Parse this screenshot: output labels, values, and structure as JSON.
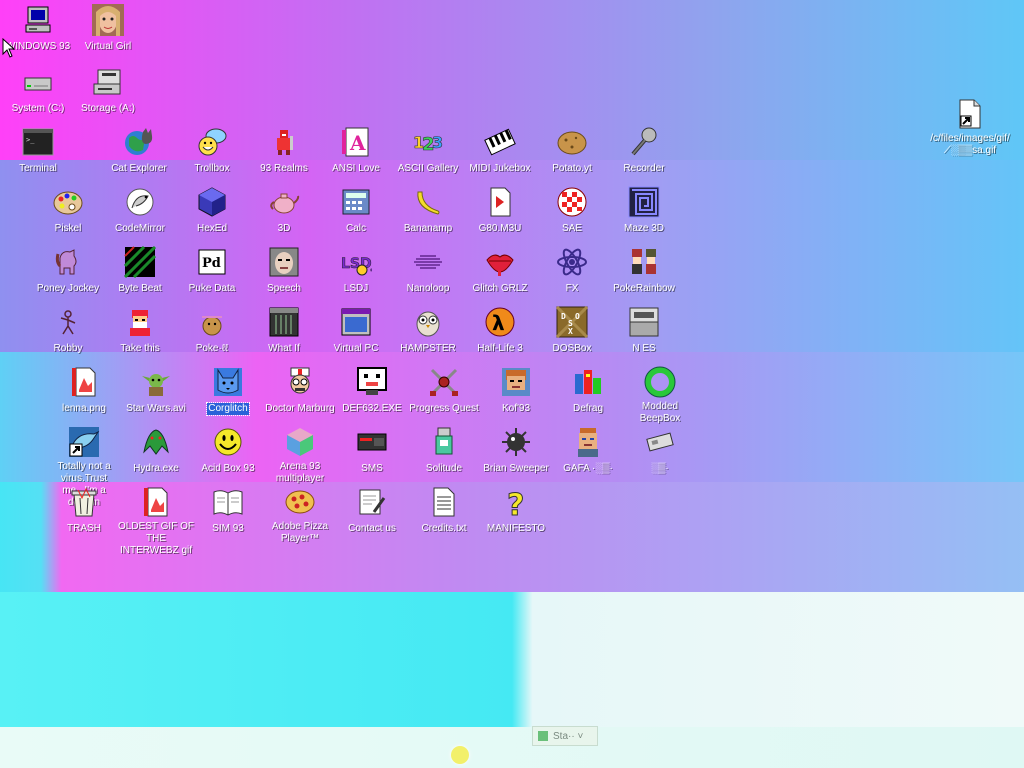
{
  "desktop": {
    "row1": [
      "WINDOWS 93",
      "Virtual Girl"
    ],
    "row2": [
      "System (C:)",
      "Storage (A:)"
    ],
    "shortcut": "/c/files/images/gif/⟋░▒▒sa.gif",
    "row3": [
      "Terminal",
      "Cat Explorer",
      "Trollbox",
      "93 Realms",
      "ANSI Love",
      "ASCII Gallery",
      "MIDI Jukebox",
      "Potato.yt",
      "Recorder"
    ],
    "row4": [
      "Piskel",
      "CodeMirror",
      "HexEd",
      "3D",
      "Calc",
      "Bananamp",
      "G80.M3U",
      "SAE",
      "Maze 3D"
    ],
    "row5": [
      "Poney Jockey",
      "Byte Beat",
      "Puke Data",
      "Speech",
      "LSDJ",
      "Nanoloop",
      "Glitch GRLZ",
      "FX",
      "PokeRainbow"
    ],
    "row6": [
      "Robby",
      "Take this",
      "Poke·ℓℓ",
      "What If",
      "Virtual PC",
      "HAMPSTER",
      "Half-Life 3",
      "DOSBox",
      "N  ES"
    ],
    "row7": [
      "lenna.png",
      "Star Wars.avi",
      "Corglitch",
      "Doctor Marburg",
      "DEF632.EXE",
      "Progress Quest",
      "Kof'93",
      "Defrag",
      "Modded BeepBox"
    ],
    "row8": [
      "Totally not a virus.Trust me...I'm a dolphin",
      "Hydra.exe",
      "Acid Box 93",
      "Arena 93 multiplayer",
      "SMS",
      "Solitude",
      "Brian Sweeper",
      "GAFA ·░▒·",
      "░▒·"
    ],
    "row9": [
      "TRASH",
      "OLDEST GIF OF THE INTERWEBZ gif",
      "SIM 93",
      "Adobe Pizza Player™",
      "Contact us",
      "Credits.txt",
      "MANIFESTO"
    ],
    "selected": "Corglitch"
  },
  "taskbar": {
    "button_label": "Sta··",
    "chevron": "˅"
  },
  "colors": {
    "selection": "#2a62d8",
    "label": "#ffffff"
  }
}
